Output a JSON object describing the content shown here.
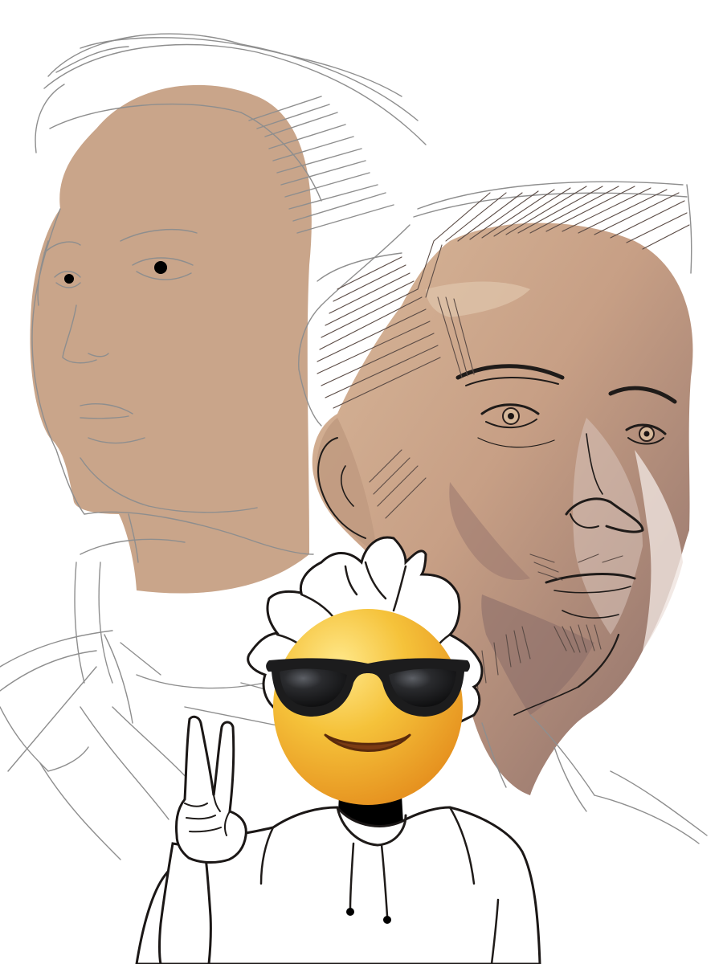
{
  "artwork": {
    "background_color": "#ffffff",
    "colors": {
      "flat_skin_tone": "#c9a58a",
      "rendered_skin_light": "#dcc1a8",
      "rendered_skin_mid": "#b98f79",
      "rendered_skin_shadow": "#8b6d68",
      "sketch_line": "#8e8e8e",
      "ink_line": "#1f1b19",
      "emoji_yellow": "#f5c23a",
      "emoji_orange": "#f0a024",
      "sunglasses": "#1c1c1d"
    },
    "icons": {
      "sketch_figure": "pencil-sketch-portrait-icon",
      "painted_figure": "painted-portrait-icon",
      "cartoon_figure": "cartoon-self-portrait-icon",
      "emoji_face": "smiling-face-with-sunglasses-icon",
      "hand_gesture": "victory-hand-icon"
    }
  }
}
